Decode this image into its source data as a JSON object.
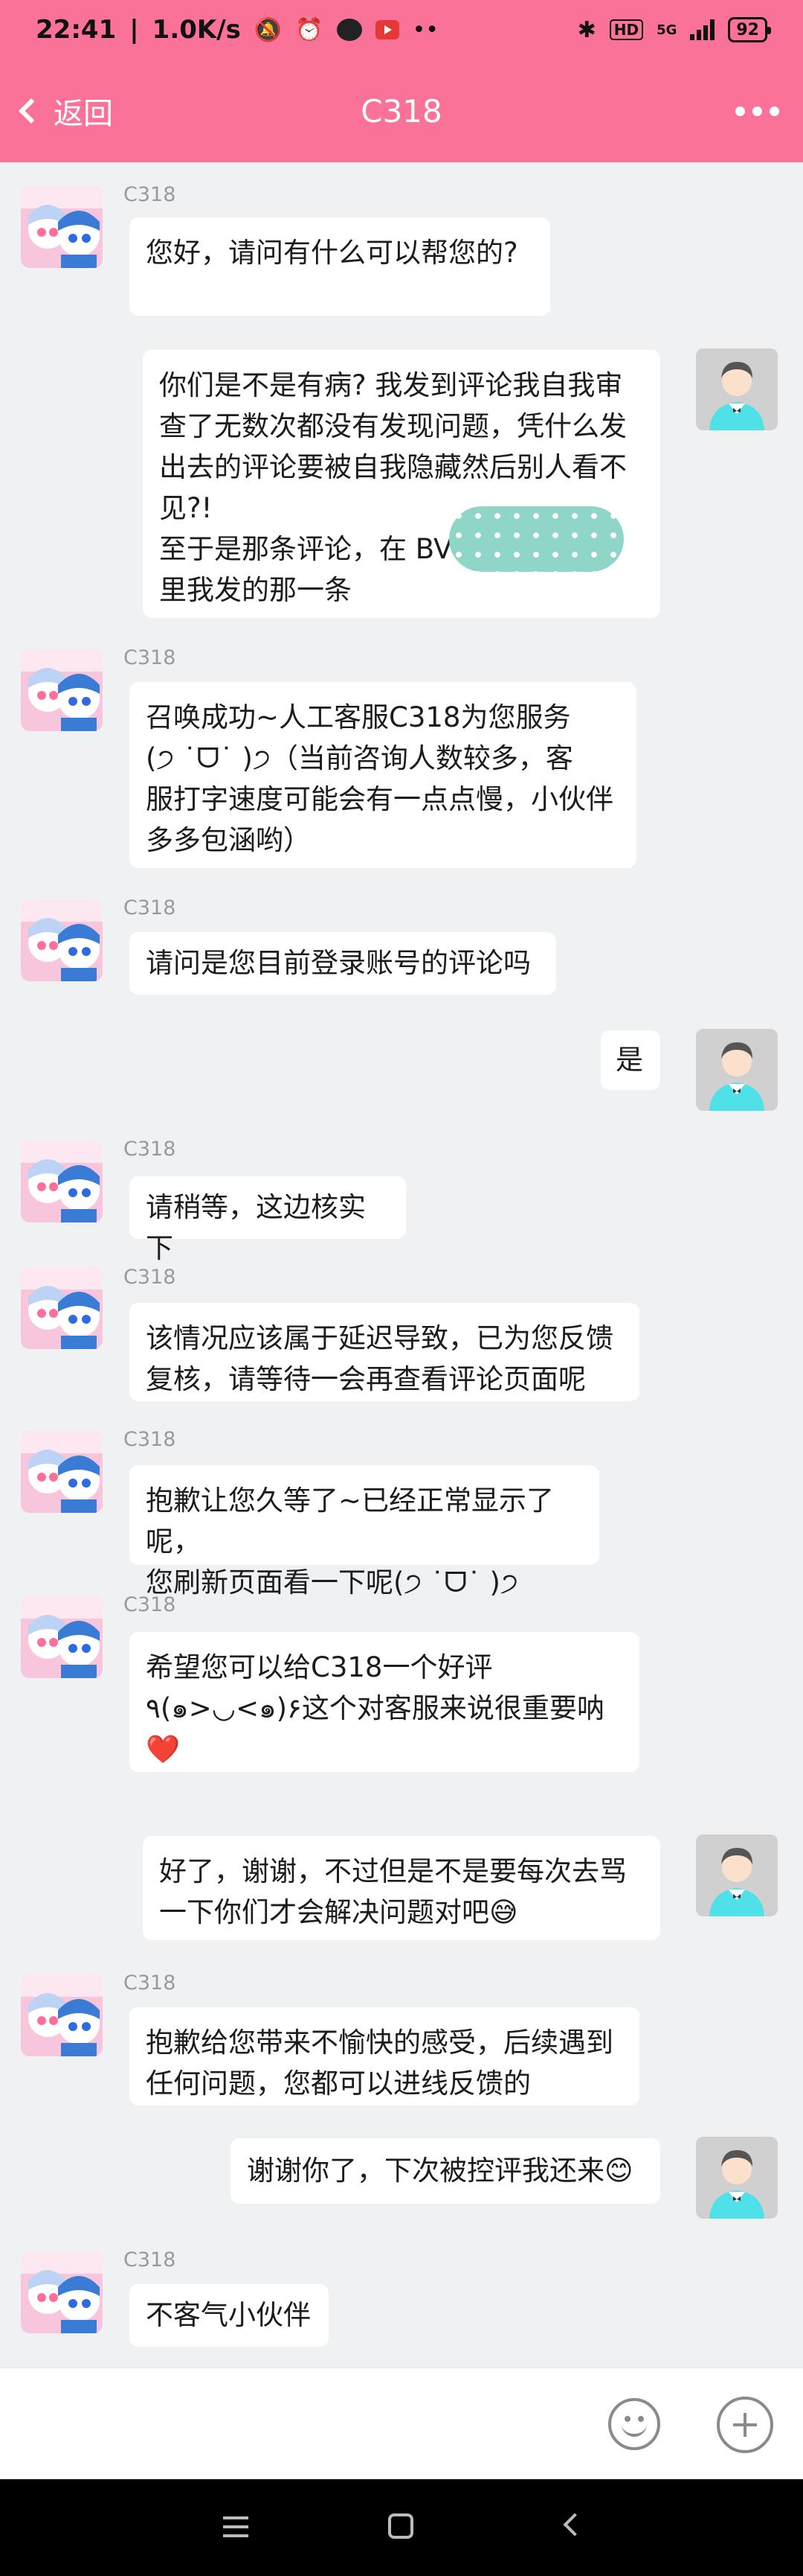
{
  "status_bar": {
    "time": "22:41",
    "speed": "1.0K/s",
    "hd": "HD",
    "network": "5G",
    "battery": "92"
  },
  "header": {
    "back_label": "返回",
    "title": "C318"
  },
  "messages": [
    {
      "from": "cs",
      "sender": "C318",
      "text": "您好，请问有什么可以帮您的?\n"
    },
    {
      "from": "user",
      "text_lines": [
        "你们是不是有病? 我发到评论我自我审",
        "查了无数次都没有发现问题，凭什么发",
        "出去的评论要被自我隐藏然后别人看不",
        "见?!",
        "至于是那条评论，在 BV",
        "里我发的那一条"
      ]
    },
    {
      "from": "cs",
      "sender": "C318",
      "text": "召唤成功~人工客服C318为您服务\n(੭ ˙ᗜ˙ )੭（当前咨询人数较多，客\n服打字速度可能会有一点点慢，小伙伴\n多多包涵哟）"
    },
    {
      "from": "cs",
      "sender": "C318",
      "text": "请问是您目前登录账号的评论吗"
    },
    {
      "from": "user",
      "text": "是"
    },
    {
      "from": "cs",
      "sender": "C318",
      "text": "请稍等，这边核实下"
    },
    {
      "from": "cs",
      "sender": "C318",
      "text": "该情况应该属于延迟导致，已为您反馈\n复核，请等待一会再查看评论页面呢"
    },
    {
      "from": "cs",
      "sender": "C318",
      "text": "抱歉让您久等了~已经正常显示了呢，\n您刷新页面看一下呢(੭ ˙ᗜ˙ )੭"
    },
    {
      "from": "cs",
      "sender": "C318",
      "text_lines": [
        "希望您可以给C318一个好评",
        "٩(๑>◡<๑)۶这个对客服来说很重要呐"
      ],
      "heart": "❤️"
    },
    {
      "from": "user",
      "text": "好了，谢谢，不过但是不是要每次去骂\n一下你们才会解决问题对吧😅"
    },
    {
      "from": "cs",
      "sender": "C318",
      "text": "抱歉给您带来不愉快的感受，后续遇到\n任何问题，您都可以进线反馈的"
    },
    {
      "from": "user",
      "text": "谢谢你了，下次被控评我还来😊"
    },
    {
      "from": "cs",
      "sender": "C318",
      "text": "不客气小伙伴"
    }
  ],
  "colors": {
    "brand_pink": "#fb7299",
    "background": "#f0f1f3"
  }
}
